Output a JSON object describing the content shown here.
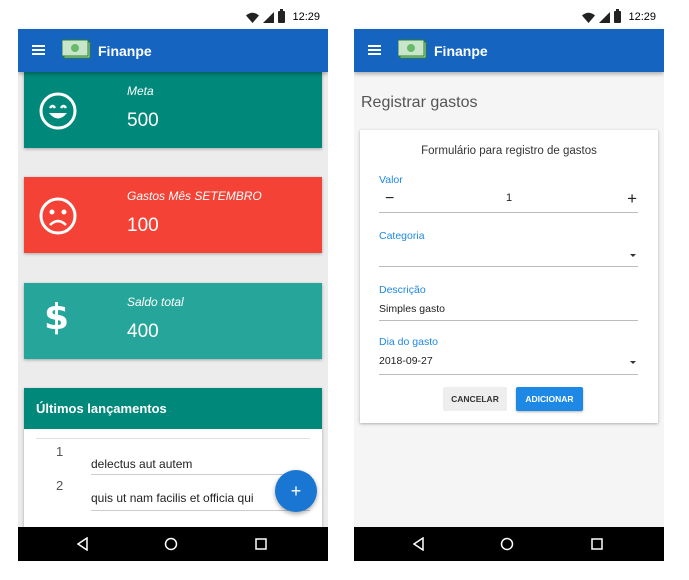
{
  "statusbar": {
    "time": "12:29"
  },
  "app": {
    "title": "Finanpe"
  },
  "dashboard": {
    "cards": [
      {
        "label": "Meta",
        "value": "500",
        "color": "#00897b"
      },
      {
        "label": "Gastos Mês SETEMBRO",
        "value": "100",
        "color": "#f44336"
      },
      {
        "label": "Saldo total",
        "value": "400",
        "color": "#26a69a"
      }
    ],
    "list": {
      "title": "Últimos lançamentos",
      "items": [
        {
          "index": "1",
          "text": "delectus aut autem"
        },
        {
          "index": "2",
          "text": "quis ut nam facilis et officia qui"
        }
      ]
    },
    "fab_label": "+"
  },
  "form": {
    "page_title": "Registrar gastos",
    "card_title": "Formulário para registro de gastos",
    "valor": {
      "label": "Valor",
      "value": "1",
      "minus": "−",
      "plus": "+"
    },
    "categoria": {
      "label": "Categoria",
      "value": ""
    },
    "descricao": {
      "label": "Descrição",
      "value": "Simples gasto"
    },
    "dia": {
      "label": "Dia do gasto",
      "value": "2018-09-27"
    },
    "cancel_label": "CANCELAR",
    "add_label": "ADICIONAR"
  },
  "colors": {
    "primary": "#1565c0",
    "accent": "#1e88e5"
  }
}
